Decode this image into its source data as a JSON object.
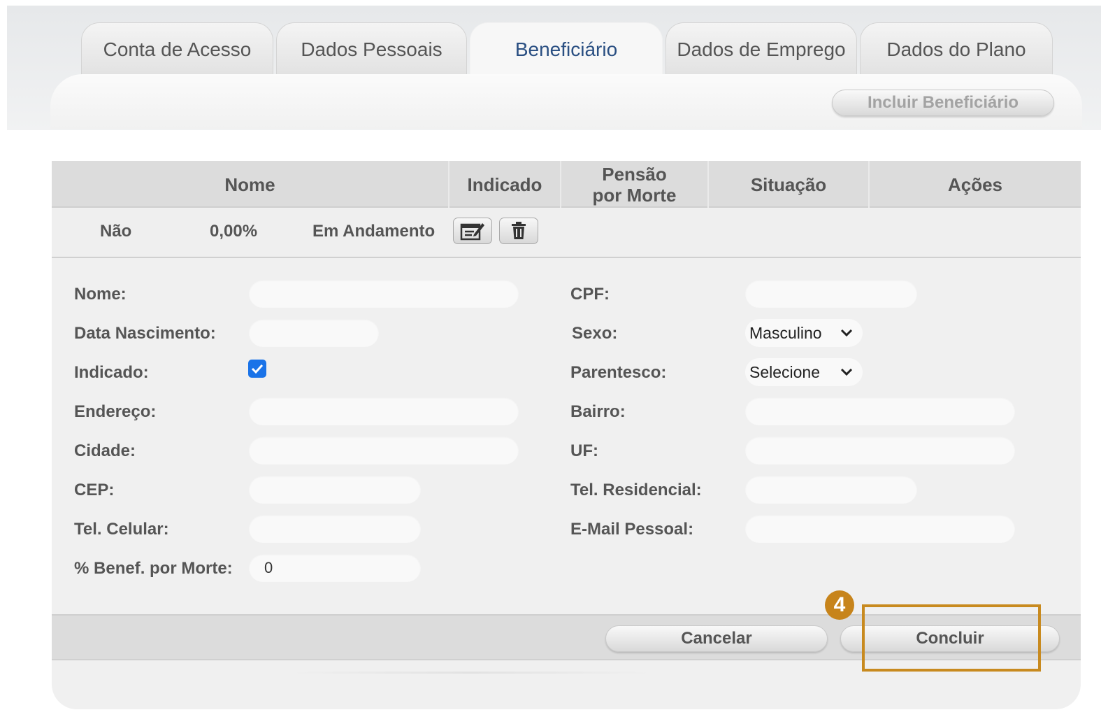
{
  "tabs": [
    {
      "label": "Conta de Acesso",
      "active": false
    },
    {
      "label": "Dados Pessoais",
      "active": false
    },
    {
      "label": "Beneficiário",
      "active": true
    },
    {
      "label": "Dados de Emprego",
      "active": false
    },
    {
      "label": "Dados do Plano",
      "active": false
    }
  ],
  "toolbar": {
    "include_label": "Incluir Beneficiário"
  },
  "table": {
    "headers": [
      "Nome",
      "Indicado",
      "Pensão por Morte",
      "Situação",
      "Ações"
    ],
    "row": {
      "indicado": "Não",
      "pensao": "0,00%",
      "situacao": "Em Andamento",
      "edit_icon": "edit-icon",
      "delete_icon": "trash-icon"
    }
  },
  "form": {
    "nome": {
      "label": "Nome:",
      "value": ""
    },
    "cpf": {
      "label": "CPF:",
      "value": ""
    },
    "data_nascimento": {
      "label": "Data Nascimento:",
      "value": ""
    },
    "sexo": {
      "label": "Sexo:",
      "value": "Masculino"
    },
    "indicado": {
      "label": "Indicado:",
      "checked": true
    },
    "parentesco": {
      "label": "Parentesco:",
      "value": "Selecione"
    },
    "endereco": {
      "label": "Endereço:",
      "value": ""
    },
    "bairro": {
      "label": "Bairro:",
      "value": ""
    },
    "cidade": {
      "label": "Cidade:",
      "value": ""
    },
    "uf": {
      "label": "UF:",
      "value": ""
    },
    "cep": {
      "label": "CEP:",
      "value": ""
    },
    "tel_residencial": {
      "label": "Tel. Residencial:",
      "value": ""
    },
    "tel_celular": {
      "label": "Tel. Celular:",
      "value": ""
    },
    "email": {
      "label": "E-Mail Pessoal:",
      "value": ""
    },
    "benef_morte": {
      "label": "% Benef. por Morte:",
      "value": "0"
    }
  },
  "footer": {
    "cancel_label": "Cancelar",
    "concluir_label": "Concluir"
  },
  "annotation": {
    "step": "4",
    "color": "#c88a1f"
  }
}
